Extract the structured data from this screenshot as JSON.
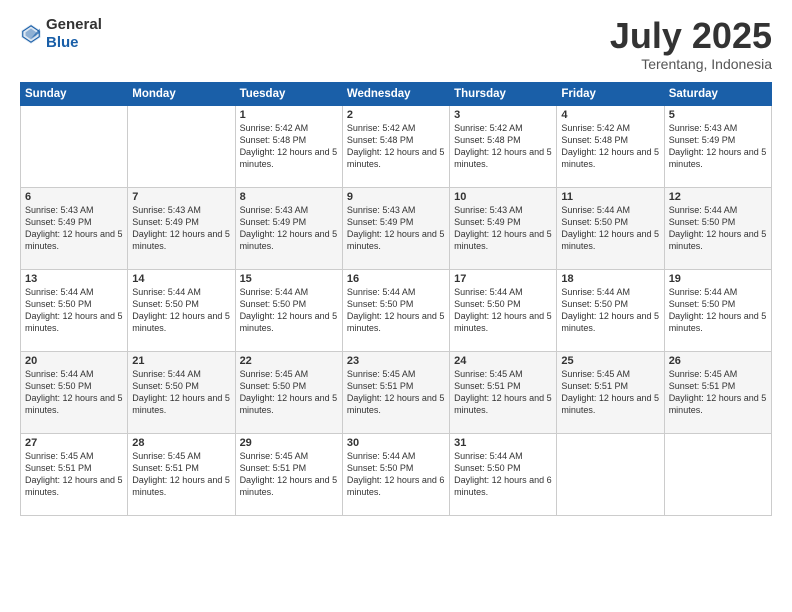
{
  "header": {
    "logo_general": "General",
    "logo_blue": "Blue",
    "month": "July 2025",
    "location": "Terentang, Indonesia"
  },
  "weekdays": [
    "Sunday",
    "Monday",
    "Tuesday",
    "Wednesday",
    "Thursday",
    "Friday",
    "Saturday"
  ],
  "weeks": [
    [
      {
        "day": "",
        "content": ""
      },
      {
        "day": "",
        "content": ""
      },
      {
        "day": "1",
        "content": "Sunrise: 5:42 AM\nSunset: 5:48 PM\nDaylight: 12 hours\nand 5 minutes."
      },
      {
        "day": "2",
        "content": "Sunrise: 5:42 AM\nSunset: 5:48 PM\nDaylight: 12 hours\nand 5 minutes."
      },
      {
        "day": "3",
        "content": "Sunrise: 5:42 AM\nSunset: 5:48 PM\nDaylight: 12 hours\nand 5 minutes."
      },
      {
        "day": "4",
        "content": "Sunrise: 5:42 AM\nSunset: 5:48 PM\nDaylight: 12 hours\nand 5 minutes."
      },
      {
        "day": "5",
        "content": "Sunrise: 5:43 AM\nSunset: 5:49 PM\nDaylight: 12 hours\nand 5 minutes."
      }
    ],
    [
      {
        "day": "6",
        "content": "Sunrise: 5:43 AM\nSunset: 5:49 PM\nDaylight: 12 hours\nand 5 minutes."
      },
      {
        "day": "7",
        "content": "Sunrise: 5:43 AM\nSunset: 5:49 PM\nDaylight: 12 hours\nand 5 minutes."
      },
      {
        "day": "8",
        "content": "Sunrise: 5:43 AM\nSunset: 5:49 PM\nDaylight: 12 hours\nand 5 minutes."
      },
      {
        "day": "9",
        "content": "Sunrise: 5:43 AM\nSunset: 5:49 PM\nDaylight: 12 hours\nand 5 minutes."
      },
      {
        "day": "10",
        "content": "Sunrise: 5:43 AM\nSunset: 5:49 PM\nDaylight: 12 hours\nand 5 minutes."
      },
      {
        "day": "11",
        "content": "Sunrise: 5:44 AM\nSunset: 5:50 PM\nDaylight: 12 hours\nand 5 minutes."
      },
      {
        "day": "12",
        "content": "Sunrise: 5:44 AM\nSunset: 5:50 PM\nDaylight: 12 hours\nand 5 minutes."
      }
    ],
    [
      {
        "day": "13",
        "content": "Sunrise: 5:44 AM\nSunset: 5:50 PM\nDaylight: 12 hours\nand 5 minutes."
      },
      {
        "day": "14",
        "content": "Sunrise: 5:44 AM\nSunset: 5:50 PM\nDaylight: 12 hours\nand 5 minutes."
      },
      {
        "day": "15",
        "content": "Sunrise: 5:44 AM\nSunset: 5:50 PM\nDaylight: 12 hours\nand 5 minutes."
      },
      {
        "day": "16",
        "content": "Sunrise: 5:44 AM\nSunset: 5:50 PM\nDaylight: 12 hours\nand 5 minutes."
      },
      {
        "day": "17",
        "content": "Sunrise: 5:44 AM\nSunset: 5:50 PM\nDaylight: 12 hours\nand 5 minutes."
      },
      {
        "day": "18",
        "content": "Sunrise: 5:44 AM\nSunset: 5:50 PM\nDaylight: 12 hours\nand 5 minutes."
      },
      {
        "day": "19",
        "content": "Sunrise: 5:44 AM\nSunset: 5:50 PM\nDaylight: 12 hours\nand 5 minutes."
      }
    ],
    [
      {
        "day": "20",
        "content": "Sunrise: 5:44 AM\nSunset: 5:50 PM\nDaylight: 12 hours\nand 5 minutes."
      },
      {
        "day": "21",
        "content": "Sunrise: 5:44 AM\nSunset: 5:50 PM\nDaylight: 12 hours\nand 5 minutes."
      },
      {
        "day": "22",
        "content": "Sunrise: 5:45 AM\nSunset: 5:50 PM\nDaylight: 12 hours\nand 5 minutes."
      },
      {
        "day": "23",
        "content": "Sunrise: 5:45 AM\nSunset: 5:51 PM\nDaylight: 12 hours\nand 5 minutes."
      },
      {
        "day": "24",
        "content": "Sunrise: 5:45 AM\nSunset: 5:51 PM\nDaylight: 12 hours\nand 5 minutes."
      },
      {
        "day": "25",
        "content": "Sunrise: 5:45 AM\nSunset: 5:51 PM\nDaylight: 12 hours\nand 5 minutes."
      },
      {
        "day": "26",
        "content": "Sunrise: 5:45 AM\nSunset: 5:51 PM\nDaylight: 12 hours\nand 5 minutes."
      }
    ],
    [
      {
        "day": "27",
        "content": "Sunrise: 5:45 AM\nSunset: 5:51 PM\nDaylight: 12 hours\nand 5 minutes."
      },
      {
        "day": "28",
        "content": "Sunrise: 5:45 AM\nSunset: 5:51 PM\nDaylight: 12 hours\nand 5 minutes."
      },
      {
        "day": "29",
        "content": "Sunrise: 5:45 AM\nSunset: 5:51 PM\nDaylight: 12 hours\nand 5 minutes."
      },
      {
        "day": "30",
        "content": "Sunrise: 5:44 AM\nSunset: 5:50 PM\nDaylight: 12 hours\nand 6 minutes."
      },
      {
        "day": "31",
        "content": "Sunrise: 5:44 AM\nSunset: 5:50 PM\nDaylight: 12 hours\nand 6 minutes."
      },
      {
        "day": "",
        "content": ""
      },
      {
        "day": "",
        "content": ""
      }
    ]
  ]
}
